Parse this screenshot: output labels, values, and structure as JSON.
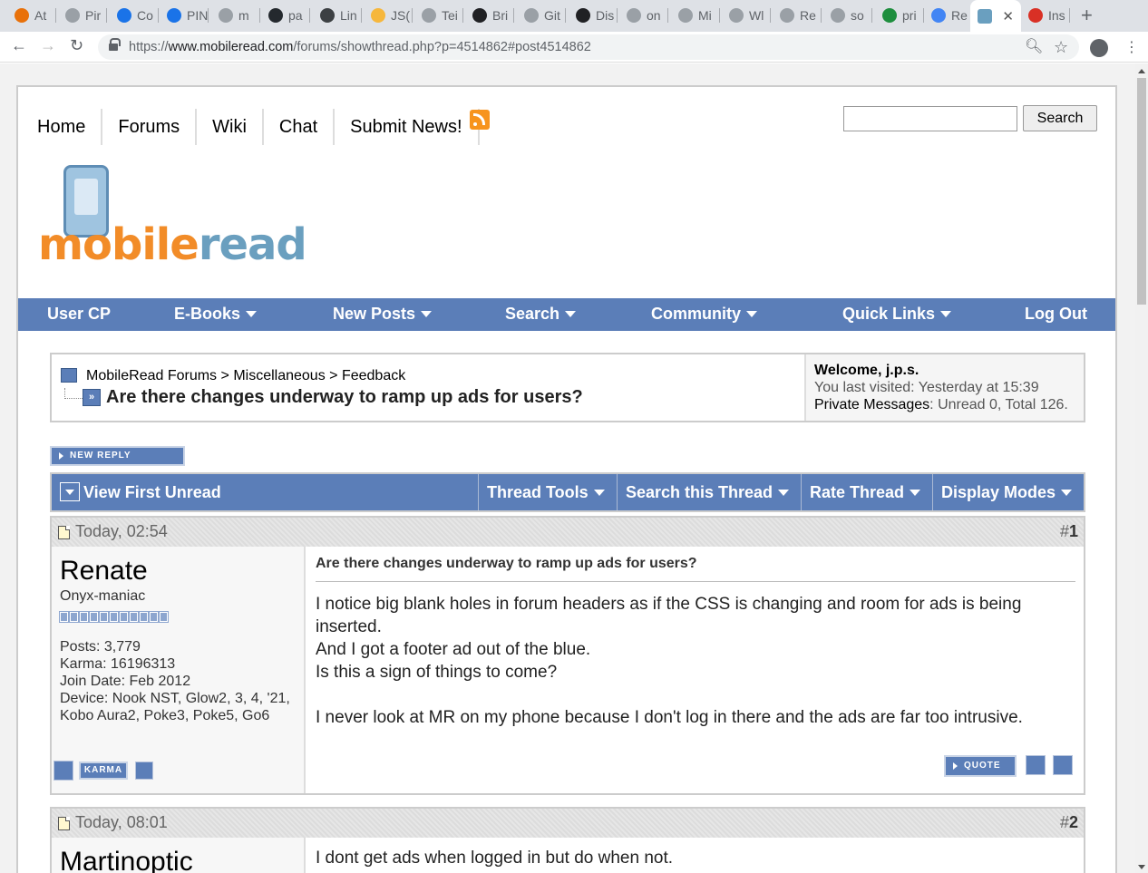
{
  "browser": {
    "tabs": [
      {
        "label": "At",
        "color": "#e8710a"
      },
      {
        "label": "Pir",
        "color": "#9aa0a6"
      },
      {
        "label": "Co",
        "color": "#1a73e8"
      },
      {
        "label": "PIN",
        "color": "#1a73e8"
      },
      {
        "label": "m",
        "color": "#9aa0a6"
      },
      {
        "label": "pa",
        "color": "#24292e"
      },
      {
        "label": "Lin",
        "color": "#3c4043"
      },
      {
        "label": "JS(",
        "color": "#f6b73c"
      },
      {
        "label": "Tei",
        "color": "#9aa0a6"
      },
      {
        "label": "Bri",
        "color": "#202124"
      },
      {
        "label": "Git",
        "color": "#9aa0a6"
      },
      {
        "label": "Dis",
        "color": "#202124"
      },
      {
        "label": "on",
        "color": "#9aa0a6"
      },
      {
        "label": "Mi",
        "color": "#9aa0a6"
      },
      {
        "label": "Wl",
        "color": "#9aa0a6"
      },
      {
        "label": "Re",
        "color": "#9aa0a6"
      },
      {
        "label": "so",
        "color": "#9aa0a6"
      },
      {
        "label": "pri",
        "color": "#1e8e3e"
      },
      {
        "label": "Re",
        "color": "#4285f4"
      }
    ],
    "active_tab_close": "✕",
    "last_tab": {
      "label": "Ins",
      "color": "#d93025"
    },
    "new_tab": "+",
    "url_prefix": "https://",
    "url_host": "www.mobileread.com",
    "url_path": "/forums/showthread.php?p=4514862#post4514862"
  },
  "site": {
    "topnav": [
      "Home",
      "Forums",
      "Wiki",
      "Chat",
      "Submit News!"
    ],
    "search_button": "Search",
    "logo_mobile": "mobile",
    "logo_read": "read",
    "mainnav": [
      "User CP",
      "E-Books",
      "New Posts",
      "Search",
      "Community",
      "Quick Links",
      "Log Out"
    ]
  },
  "breadcrumb": {
    "root": "MobileRead Forums",
    "sep1": ">",
    "cat": "Miscellaneous",
    "sep2": ">",
    "forum": "Feedback",
    "thread_title": "Are there changes underway to ramp up ads for users?"
  },
  "welcome": {
    "label": "Welcome,",
    "user": "j.p.s.",
    "last_visited": "You last visited: Yesterday at 15:39",
    "pm_label": "Private Messages",
    "pm_value": ": Unread 0, Total 126."
  },
  "new_reply": "NEW REPLY",
  "threadbar": [
    "View First Unread",
    "Thread Tools",
    "Search this Thread",
    "Rate Thread",
    "Display Modes"
  ],
  "posts": [
    {
      "date": "Today, 02:54",
      "number": "1",
      "username": "Renate",
      "user_title": "Onyx-maniac",
      "posts": "Posts: 3,779",
      "karma": "Karma: 16196313",
      "join": "Join Date: Feb 2012",
      "device": "Device: Nook NST, Glow2, 3, 4, '21, Kobo Aura2, Poke3, Poke5, Go6",
      "title": "Are there changes underway to ramp up ads for users?",
      "lines": [
        "I notice big blank holes in forum headers as if the CSS is changing and room for ads is being inserted.",
        "And I got a footer ad out of the blue.",
        "Is this a sign of things to come?",
        "I never look at MR on my phone because I don't log in there and the ads are far too intrusive."
      ],
      "karma_button": "KARMA",
      "quote_button": "QUOTE"
    },
    {
      "date": "Today, 08:01",
      "number": "2",
      "username": "Martinoptic",
      "line": "I dont get ads when logged in but do when not."
    }
  ]
}
